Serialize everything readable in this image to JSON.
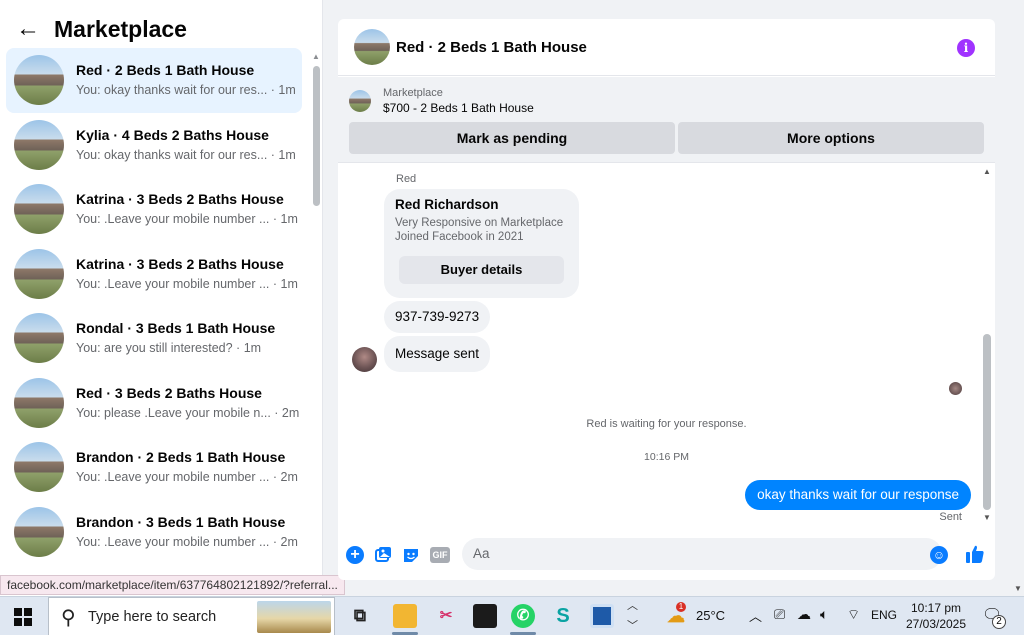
{
  "sidebar": {
    "back_symbol": "←",
    "title": "Marketplace",
    "conversations": [
      {
        "name": "Red · 2 Beds 1 Bath House",
        "preview": "You: okay thanks wait for our res... · 1m"
      },
      {
        "name": "Kylia · 4 Beds 2 Baths House",
        "preview": "You: okay thanks wait for our res... · 1m"
      },
      {
        "name": "Katrina · 3 Beds 2 Baths House",
        "preview": "You: .Leave your mobile number ... · 1m"
      },
      {
        "name": "Katrina · 3 Beds 2 Baths House",
        "preview": "You: .Leave your mobile number ... · 1m"
      },
      {
        "name": "Rondal · 3 Beds 1 Bath House",
        "preview": "You: are you still interested? · 1m"
      },
      {
        "name": "Red · 3 Beds 2 Baths House",
        "preview": "You: please .Leave your mobile n... · 2m"
      },
      {
        "name": "Brandon · 2 Beds 1 Bath House",
        "preview": "You: .Leave your mobile number ... · 2m"
      },
      {
        "name": "Brandon · 3 Beds 1 Bath House",
        "preview": "You: .Leave your mobile number ... · 2m"
      }
    ]
  },
  "status_url": "facebook.com/marketplace/item/637764802121892/?referral...",
  "chat": {
    "title": "Red · 2 Beds 1 Bath House",
    "info_symbol": "i",
    "listing": {
      "source": "Marketplace",
      "price_title": "$700 - 2 Beds 1 Bath House",
      "mark_pending": "Mark as pending",
      "more_options": "More options"
    },
    "sender_label": "Red",
    "profile": {
      "name": "Red Richardson",
      "line1": "Very Responsive on Marketplace",
      "line2": "Joined Facebook in 2021",
      "button": "Buyer details"
    },
    "phone": "937-739-9273",
    "message_sent": "Message sent",
    "waiting": "Red is waiting for your response.",
    "time": "10:16 PM",
    "outgoing": "okay thanks wait for our response",
    "sent_label": "Sent",
    "composer": {
      "placeholder": "Aa",
      "gif": "GIF"
    }
  },
  "taskbar": {
    "search_placeholder": "Type here to search",
    "weather_badge": "1",
    "temperature": "25°C",
    "language": "ENG",
    "time": "10:17 pm",
    "date": "27/03/2025",
    "notifications": "2"
  },
  "colors": {
    "accent": "#0084ff",
    "info": "#a033ff",
    "active_item": "#e7f3ff"
  }
}
